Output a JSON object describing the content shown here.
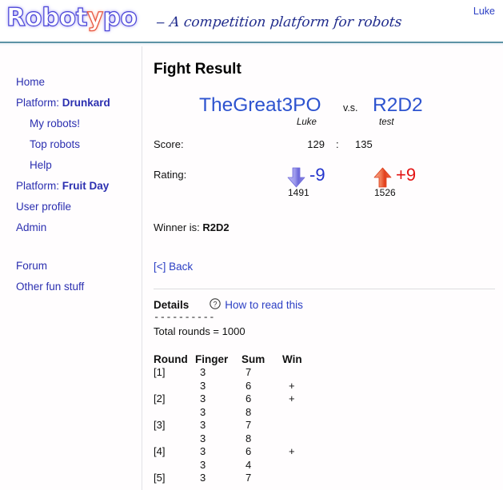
{
  "header": {
    "logo_text": "Robotypo",
    "logo_red_letter_index": 5,
    "tagline": "– A competition platform for robots",
    "user_link": "Luke",
    "rule_color": "#5d93a6"
  },
  "sidebar": {
    "items": [
      {
        "label": "Home",
        "strong": "",
        "indent": false
      },
      {
        "label": "Platform: ",
        "strong": "Drunkard",
        "indent": false
      },
      {
        "label": "My robots!",
        "strong": "",
        "indent": true
      },
      {
        "label": "Top robots",
        "strong": "",
        "indent": true
      },
      {
        "label": "Help",
        "strong": "",
        "indent": true
      },
      {
        "label": "Platform: ",
        "strong": "Fruit Day",
        "indent": false
      },
      {
        "label": "User profile",
        "strong": "",
        "indent": false
      },
      {
        "label": "Admin",
        "strong": "",
        "indent": false
      },
      {
        "label": "Forum",
        "strong": "",
        "indent": false,
        "gap_before": true
      },
      {
        "label": "Other fun stuff",
        "strong": "",
        "indent": false
      }
    ]
  },
  "main": {
    "page_title": "Fight Result",
    "versus": {
      "left_name": "TheGreat3PO",
      "left_owner": "Luke",
      "vs_word": "v.s.",
      "right_name": "R2D2",
      "right_owner": "test",
      "name_color": "#2d53cf"
    },
    "score": {
      "label": "Score:",
      "left": "129",
      "separator": ":",
      "right": "135"
    },
    "rating": {
      "label": "Rating:",
      "left_delta": "-9",
      "left_value": "1491",
      "left_arrow": "arrow-down-icon",
      "left_color": "#2233cc",
      "right_delta": "+9",
      "right_value": "1526",
      "right_arrow": "arrow-up-icon",
      "right_color": "#e31414"
    },
    "winner": {
      "label": "Winner is: ",
      "name": "R2D2"
    },
    "back_link": "[<] Back",
    "details": {
      "title": "Details",
      "how_to_read": "How to read this",
      "dashes": "----------",
      "total_rounds": "Total rounds = 1000"
    },
    "rounds": {
      "columns": [
        "Round",
        "Finger",
        "Sum",
        "Win"
      ],
      "rows": [
        {
          "round": "[1]",
          "finger": "3",
          "sum": "7",
          "win": ""
        },
        {
          "round": "",
          "finger": "3",
          "sum": "6",
          "win": "+"
        },
        {
          "round": "[2]",
          "finger": "3",
          "sum": "6",
          "win": "+"
        },
        {
          "round": "",
          "finger": "3",
          "sum": "8",
          "win": ""
        },
        {
          "round": "[3]",
          "finger": "3",
          "sum": "7",
          "win": ""
        },
        {
          "round": "",
          "finger": "3",
          "sum": "8",
          "win": ""
        },
        {
          "round": "[4]",
          "finger": "3",
          "sum": "6",
          "win": "+"
        },
        {
          "round": "",
          "finger": "3",
          "sum": "4",
          "win": ""
        },
        {
          "round": "[5]",
          "finger": "3",
          "sum": "7",
          "win": ""
        }
      ]
    }
  }
}
